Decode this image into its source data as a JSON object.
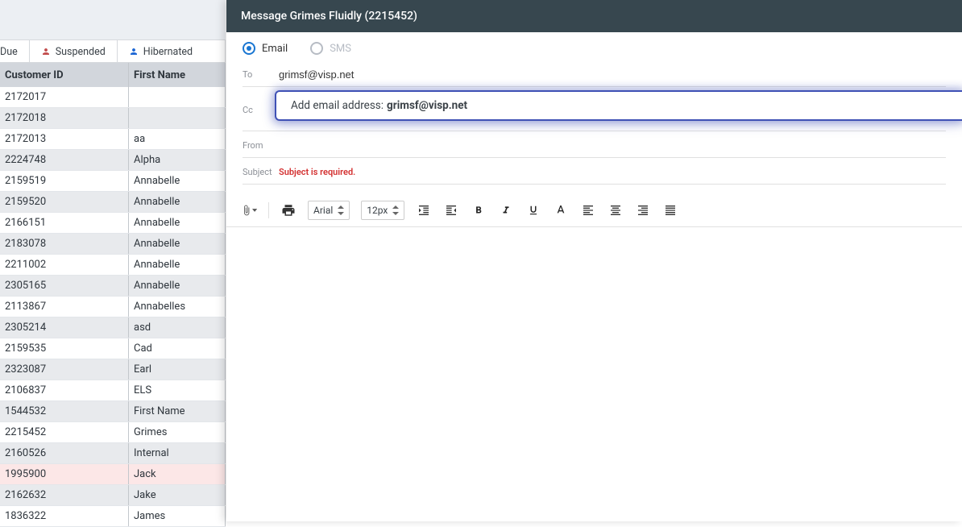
{
  "filters": {
    "due": "Due",
    "suspended": "Suspended",
    "hibernated": "Hibernated"
  },
  "table": {
    "headers": {
      "id": "Customer ID",
      "first": "First Name"
    },
    "rows": [
      {
        "id": "2172017",
        "first": ""
      },
      {
        "id": "2172018",
        "first": ""
      },
      {
        "id": "2172013",
        "first": "aa"
      },
      {
        "id": "2224748",
        "first": "Alpha"
      },
      {
        "id": "2159519",
        "first": "Annabelle"
      },
      {
        "id": "2159520",
        "first": "Annabelle"
      },
      {
        "id": "2166151",
        "first": "Annabelle"
      },
      {
        "id": "2183078",
        "first": "Annabelle"
      },
      {
        "id": "2211002",
        "first": "Annabelle"
      },
      {
        "id": "2305165",
        "first": "Annabelle"
      },
      {
        "id": "2113867",
        "first": "Annabelles"
      },
      {
        "id": "2305214",
        "first": "asd"
      },
      {
        "id": "2159535",
        "first": "Cad"
      },
      {
        "id": "2323087",
        "first": "Earl"
      },
      {
        "id": "2106837",
        "first": "ELS"
      },
      {
        "id": "1544532",
        "first": "First Name"
      },
      {
        "id": "2215452",
        "first": "Grimes"
      },
      {
        "id": "2160526",
        "first": "Internal"
      },
      {
        "id": "1995900",
        "first": "Jack",
        "highlight": true
      },
      {
        "id": "2162632",
        "first": "Jake"
      },
      {
        "id": "1836322",
        "first": "James"
      }
    ]
  },
  "compose": {
    "title": "Message Grimes Fluidly (2215452)",
    "mode": {
      "email": "Email",
      "sms": "SMS"
    },
    "labels": {
      "to": "To",
      "cc": "Cc",
      "from": "From",
      "subject": "Subject"
    },
    "to_value": "grimsf@visp.net",
    "suggest_prefix": "Add email address:",
    "suggest_value": "grimsf@visp.net",
    "subject_error": "Subject is required.",
    "toolbar": {
      "font": "Arial",
      "size": "12px"
    }
  }
}
